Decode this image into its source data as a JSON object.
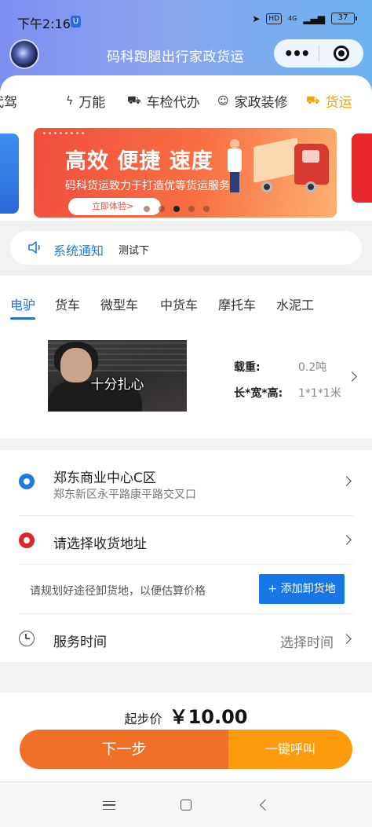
{
  "status": {
    "time": "下午2:16",
    "hd": "HD",
    "network": "4G",
    "battery": "37"
  },
  "header": {
    "title": "码科跑腿出行家政货运"
  },
  "categories": [
    {
      "label": "代驾",
      "icon": "steering-icon",
      "active": false
    },
    {
      "label": "万能",
      "icon": "lightning-icon",
      "active": false
    },
    {
      "label": "车检代办",
      "icon": "car-check-icon",
      "active": false
    },
    {
      "label": "家政装修",
      "icon": "worker-icon",
      "active": false
    },
    {
      "label": "货运",
      "icon": "truck-icon",
      "active": true
    }
  ],
  "banner": {
    "headline": "高效 便捷 速度",
    "subtitle": "码科货运致力于打造优等货运服务",
    "button_label": "立即体验>",
    "pages": 5,
    "current_page": 2
  },
  "notice": {
    "label": "系统通知",
    "text": "测试下"
  },
  "vehicle_tabs": [
    "电驴",
    "货车",
    "微型车",
    "中货车",
    "摩托车",
    "水泥工"
  ],
  "vehicle_tab_active": 0,
  "vehicle": {
    "image_caption": "十分扎心",
    "load_label": "载重:",
    "load_value": "0.2吨",
    "size_label": "长*宽*高:",
    "size_value": "1*1*1米"
  },
  "address": {
    "pickup_title": "郑东商业中心C区",
    "pickup_sub": "郑东新区永平路康平路交叉口",
    "dropoff_placeholder": "请选择收货地址",
    "plan_tip": "请规划好途径卸货地，以便估算价格",
    "add_stop_label": "+ 添加卸货地",
    "service_time_label": "服务时间",
    "service_time_value": "选择时间"
  },
  "footer": {
    "price_label": "起步价",
    "price_value": "￥10.00",
    "next_label": "下一步",
    "call_label": "一键呼叫"
  },
  "colors": {
    "accent_blue": "#1e7bdf",
    "accent_orange": "#f07027",
    "accent_amber": "#fe9b0d",
    "active_category": "#f1a500"
  }
}
